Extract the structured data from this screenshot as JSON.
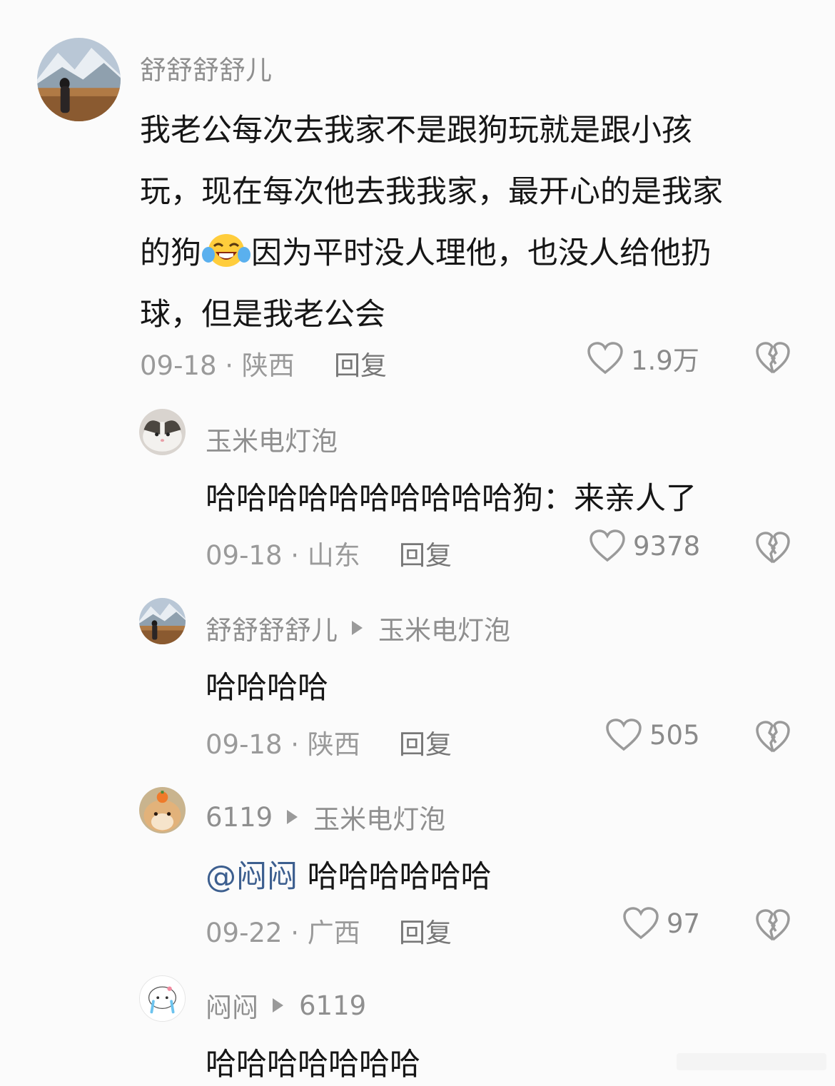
{
  "comments": [
    {
      "username": "舒舒舒舒儿",
      "text_lines": [
        "我老公每次去我家不是跟狗玩就是跟小孩",
        "玩，现在每次他去我我家，最开心的是我家",
        "的狗",
        "因为平时没人理他，也没人给他扔",
        "球，但是我老公会"
      ],
      "date_location": "09-18 · 陕西",
      "reply_label": "回复",
      "likes": "1.9万",
      "emoji": "laughing-crying-emoji"
    },
    {
      "username": "玉米电灯泡",
      "text": "哈哈哈哈哈哈哈哈哈哈狗：来亲人了",
      "date_location": "09-18 · 山东",
      "reply_label": "回复",
      "likes": "9378"
    },
    {
      "username": "舒舒舒舒儿",
      "reply_to": "玉米电灯泡",
      "text": "哈哈哈哈",
      "date_location": "09-18 · 陕西",
      "reply_label": "回复",
      "likes": "505"
    },
    {
      "username": "6119",
      "reply_to": "玉米电灯泡",
      "mention": "@闷闷",
      "text": " 哈哈哈哈哈哈",
      "date_location": "09-22 · 广西",
      "reply_label": "回复",
      "likes": "97"
    },
    {
      "username": "闷闷",
      "reply_to": "6119",
      "text": "哈哈哈哈哈哈哈"
    }
  ],
  "colors": {
    "background": "#fbfbfb",
    "username": "#8f8f8f",
    "text": "#161616",
    "meta": "#9a9a9a",
    "mention": "#3d5f8f"
  }
}
